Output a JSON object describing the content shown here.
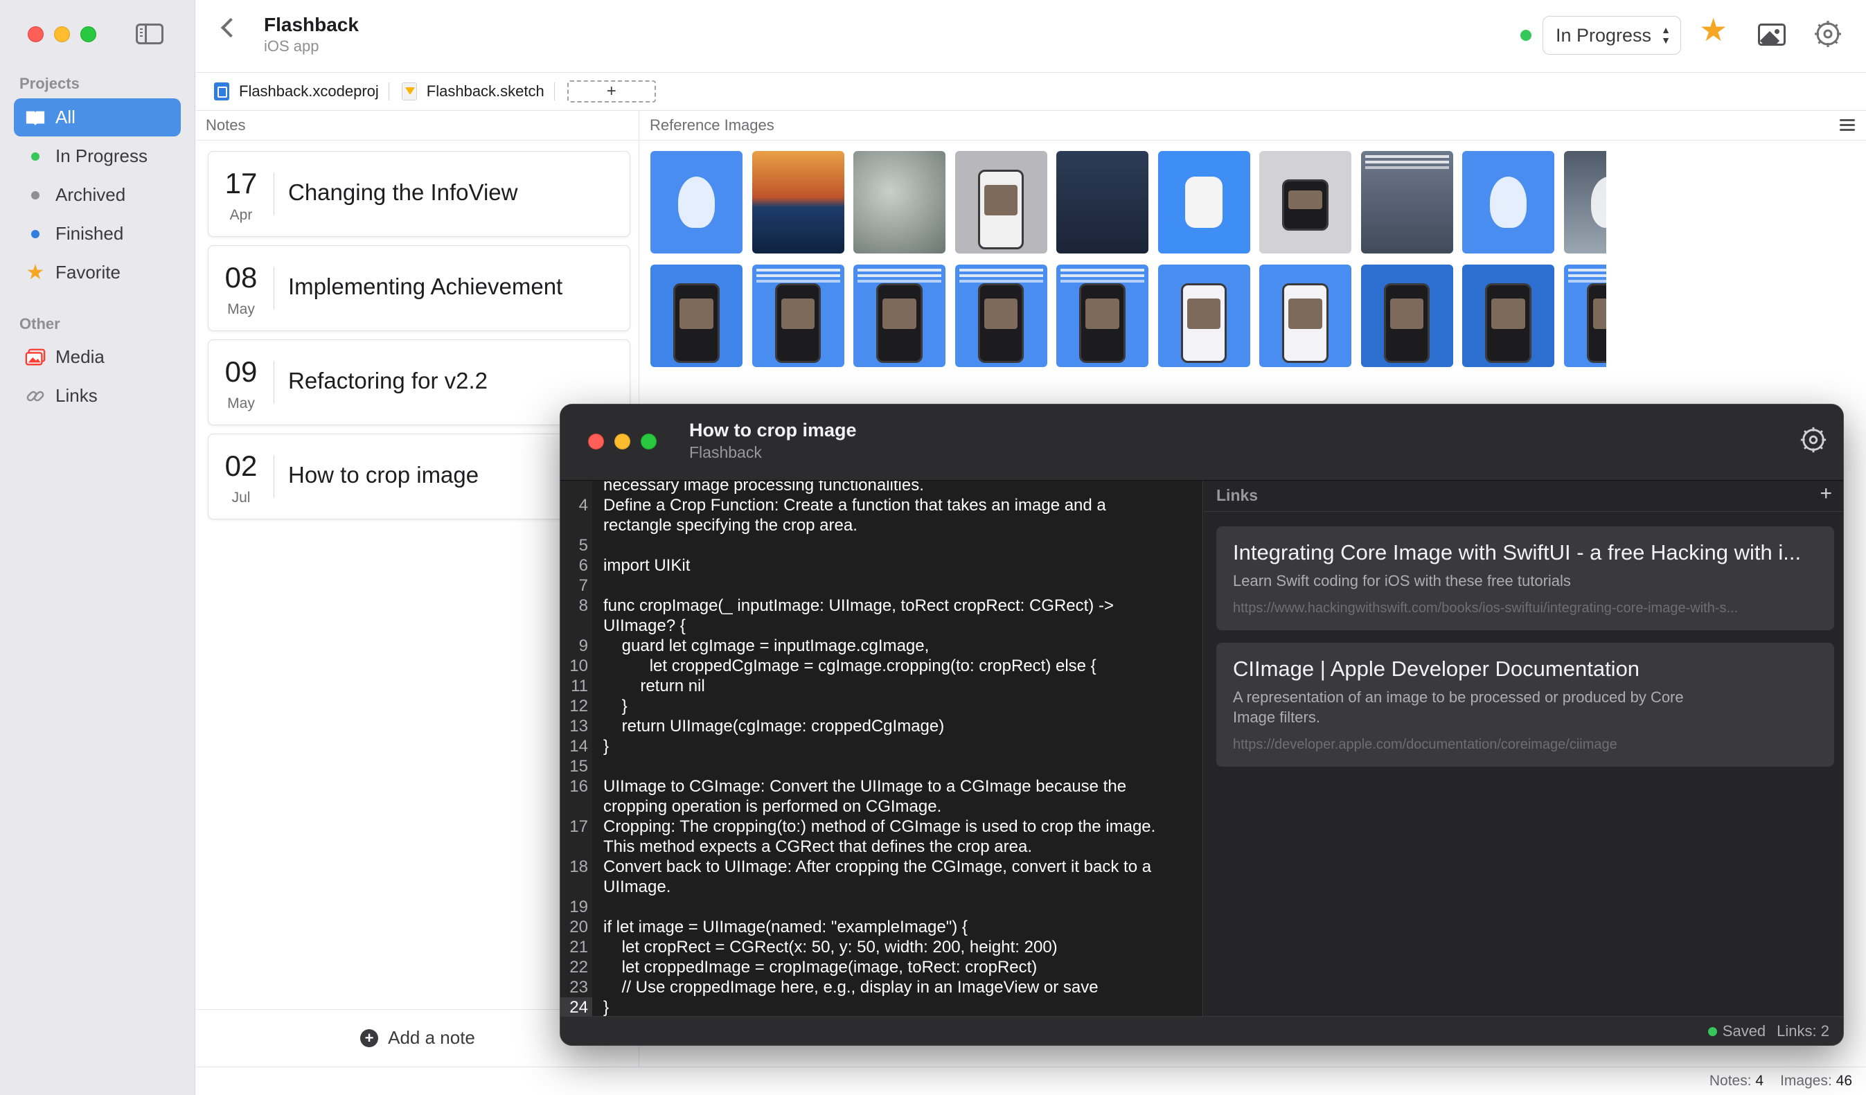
{
  "sidebar": {
    "projects_header": "Projects",
    "other_header": "Other",
    "items": [
      {
        "label": "All"
      },
      {
        "label": "In Progress",
        "color": "#34c759"
      },
      {
        "label": "Archived",
        "color": "#8e8e93"
      },
      {
        "label": "Finished",
        "color": "#2f7de1"
      },
      {
        "label": "Favorite",
        "icon": "star-icon",
        "color": "#f5a623"
      }
    ],
    "other_items": [
      {
        "label": "Media",
        "icon": "photo-stack-icon"
      },
      {
        "label": "Links",
        "icon": "link-icon"
      }
    ]
  },
  "header": {
    "title": "Flashback",
    "subtitle": "iOS app",
    "status": "In Progress",
    "status_color": "#34c759"
  },
  "files": [
    {
      "name": "Flashback.xcodeproj",
      "icon": "xcode-file-icon"
    },
    {
      "name": "Flashback.sketch",
      "icon": "sketch-file-icon"
    }
  ],
  "add_file_label": "+",
  "notes": {
    "header": "Notes",
    "items": [
      {
        "day": "17",
        "month": "Apr",
        "title": "Changing the InfoView"
      },
      {
        "day": "08",
        "month": "May",
        "title": "Implementing Achievement"
      },
      {
        "day": "09",
        "month": "May",
        "title": "Refactoring for v2.2"
      },
      {
        "day": "02",
        "month": "Jul",
        "title": "How to crop image"
      }
    ],
    "add_label": "Add a note"
  },
  "reference": {
    "header": "Reference Images"
  },
  "status_bar": {
    "notes_label": "Notes:",
    "notes_count": "4",
    "images_label": "Images:",
    "images_count": "46"
  },
  "note_window": {
    "title": "How to crop image",
    "subtitle": "Flashback",
    "lines": [
      {
        "n": "",
        "text": "necessary image processing functionalities."
      },
      {
        "n": "4",
        "text": "Define a Crop Function: Create a function that takes an image and a\nrectangle specifying the crop area."
      },
      {
        "n": "5",
        "text": ""
      },
      {
        "n": "6",
        "text": "import UIKit"
      },
      {
        "n": "7",
        "text": ""
      },
      {
        "n": "8",
        "text": "func cropImage(_ inputImage: UIImage, toRect cropRect: CGRect) ->\nUIImage? {"
      },
      {
        "n": "9",
        "text": "    guard let cgImage = inputImage.cgImage,"
      },
      {
        "n": "10",
        "text": "          let croppedCgImage = cgImage.cropping(to: cropRect) else {"
      },
      {
        "n": "11",
        "text": "        return nil"
      },
      {
        "n": "12",
        "text": "    }"
      },
      {
        "n": "13",
        "text": "    return UIImage(cgImage: croppedCgImage)"
      },
      {
        "n": "14",
        "text": "}"
      },
      {
        "n": "15",
        "text": ""
      },
      {
        "n": "16",
        "text": "UIImage to CGImage: Convert the UIImage to a CGImage because the\ncropping operation is performed on CGImage."
      },
      {
        "n": "17",
        "text": "Cropping: The cropping(to:) method of CGImage is used to crop the image.\nThis method expects a CGRect that defines the crop area."
      },
      {
        "n": "18",
        "text": "Convert back to UIImage: After cropping the CGImage, convert it back to a\nUIImage."
      },
      {
        "n": "19",
        "text": ""
      },
      {
        "n": "20",
        "text": "if let image = UIImage(named: \"exampleImage\") {"
      },
      {
        "n": "21",
        "text": "    let cropRect = CGRect(x: 50, y: 50, width: 200, height: 200)"
      },
      {
        "n": "22",
        "text": "    let croppedImage = cropImage(image, toRect: cropRect)"
      },
      {
        "n": "23",
        "text": "    // Use croppedImage here, e.g., display in an ImageView or save"
      },
      {
        "n": "24",
        "text": "}"
      }
    ],
    "links_header": "Links",
    "links_add": "+",
    "links": [
      {
        "title": "Integrating Core Image with SwiftUI - a free Hacking with i...",
        "desc": "Learn Swift coding for iOS with these free tutorials",
        "url": "https://www.hackingwithswift.com/books/ios-swiftui/integrating-core-image-with-s..."
      },
      {
        "title": "CIImage | Apple Developer Documentation",
        "desc": "A representation of an image to be processed or produced by Core\nImage filters.",
        "url": "https://developer.apple.com/documentation/coreimage/ciimage"
      }
    ],
    "saved_label": "Saved",
    "links_count_label": "Links: 2"
  }
}
